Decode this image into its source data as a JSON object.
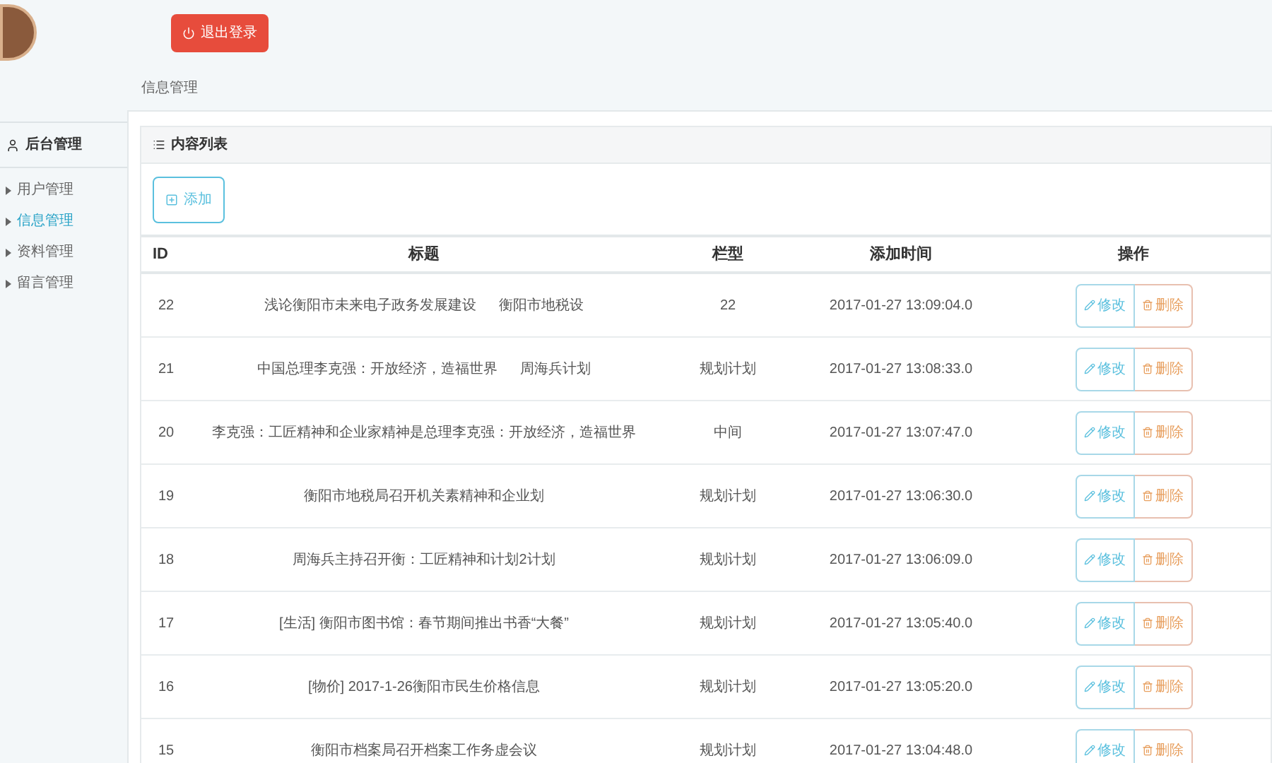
{
  "header": {
    "logout_button": "退出登录"
  },
  "breadcrumb": "信息管理",
  "sidebar": {
    "title": "后台管理",
    "items": [
      {
        "label": "用户管理",
        "selected": false
      },
      {
        "label": "信息管理",
        "selected": true
      },
      {
        "label": "资料管理",
        "selected": false
      },
      {
        "label": "留言管理",
        "selected": false
      }
    ]
  },
  "panel": {
    "title": "内容列表",
    "add_button": "添加"
  },
  "table": {
    "columns": [
      "ID",
      "标题",
      "栏型",
      "添加时间",
      "操作"
    ],
    "rows": [
      {
        "id": "22",
        "title": "浅论衡阳市未来电子政务发展建设",
        "note": "衡阳市地税设",
        "type": "22",
        "time": "2017-01-27 13:09:04.0",
        "edit": "修改",
        "delete": "删除"
      },
      {
        "id": "21",
        "title": "中国总理李克强：开放经济，造福世界",
        "note": "周海兵计划",
        "type": "规划计划",
        "time": "2017-01-27 13:08:33.0",
        "edit": "修改",
        "delete": "删除"
      },
      {
        "id": "20",
        "title": "李克强：工匠精神和企业家精神是总理李克强：开放经济，造福世界",
        "type": "中间",
        "time": "2017-01-27 13:07:47.0",
        "edit": "修改",
        "delete": "删除"
      },
      {
        "id": "19",
        "title": "衡阳市地税局召开机关素精神和企业划",
        "type": "规划计划",
        "time": "2017-01-27 13:06:30.0",
        "edit": "修改",
        "delete": "删除"
      },
      {
        "id": "18",
        "title": "周海兵主持召开衡：工匠精神和计划2计划",
        "type": "规划计划",
        "time": "2017-01-27 13:06:09.0",
        "edit": "修改",
        "delete": "删除"
      },
      {
        "id": "17",
        "title": "[生活] 衡阳市图书馆：春节期间推出书香“大餐”",
        "type": "规划计划",
        "time": "2017-01-27 13:05:40.0",
        "edit": "修改",
        "delete": "删除"
      },
      {
        "id": "16",
        "title": "[物价] 2017-1-26衡阳市民生价格信息",
        "type": "规划计划",
        "time": "2017-01-27 13:05:20.0",
        "edit": "修改",
        "delete": "删除"
      },
      {
        "id": "15",
        "title": "衡阳市档案局召开档案工作务虚会议",
        "type": "规划计划",
        "time": "2017-01-27 13:04:48.0",
        "edit": "修改",
        "delete": "删除"
      }
    ]
  }
}
